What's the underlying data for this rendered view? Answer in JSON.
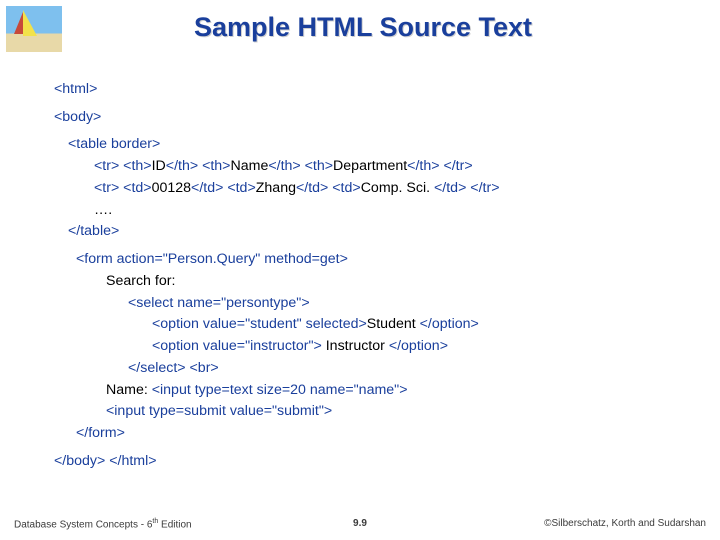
{
  "title": "Sample HTML Source Text",
  "code": {
    "html_open": "<html>",
    "body_open": "<body>",
    "table_open": "<table border>",
    "tr1_a": "<tr> <th>",
    "tr1_id": "ID",
    "tr1_b": "</th> <th>",
    "tr1_name": "Name",
    "tr1_c": "</th> <th>",
    "tr1_dept": "Department",
    "tr1_d": "</th> </tr>",
    "tr2_a": "<tr> <td>",
    "tr2_id": "00128",
    "tr2_b": "</td> <td>",
    "tr2_name": "Zhang",
    "tr2_c": "</td> <td>",
    "tr2_dept": "Comp. Sci. ",
    "tr2_d": "</td> </tr>",
    "ellipsis": "….",
    "table_close": "</table>",
    "form_open": "<form action=\"Person.Query\" method=get>",
    "search_for": "Search for: ",
    "select_open": "<select name=\"persontype\">",
    "opt1_a": "<option value=\"student\" selected>",
    "opt1_txt": "Student ",
    "opt1_b": "</option>",
    "opt2_a": "<option value=\"instructor\"> ",
    "opt2_txt": "Instructor ",
    "opt2_b": "</option>",
    "select_close": "</select> <br>",
    "name_lead": "Name: ",
    "input_name": "<input type=text size=20 name=\"name\">",
    "input_submit": "<input type=submit value=\"submit\">",
    "form_close": "</form>",
    "body_close_a": "</body>",
    "body_close_b": " </html>"
  },
  "footer": {
    "left_a": "Database System Concepts - 6",
    "left_sup": "th",
    "left_b": " Edition",
    "center": "9.9",
    "right": "©Silberschatz, Korth and Sudarshan"
  }
}
